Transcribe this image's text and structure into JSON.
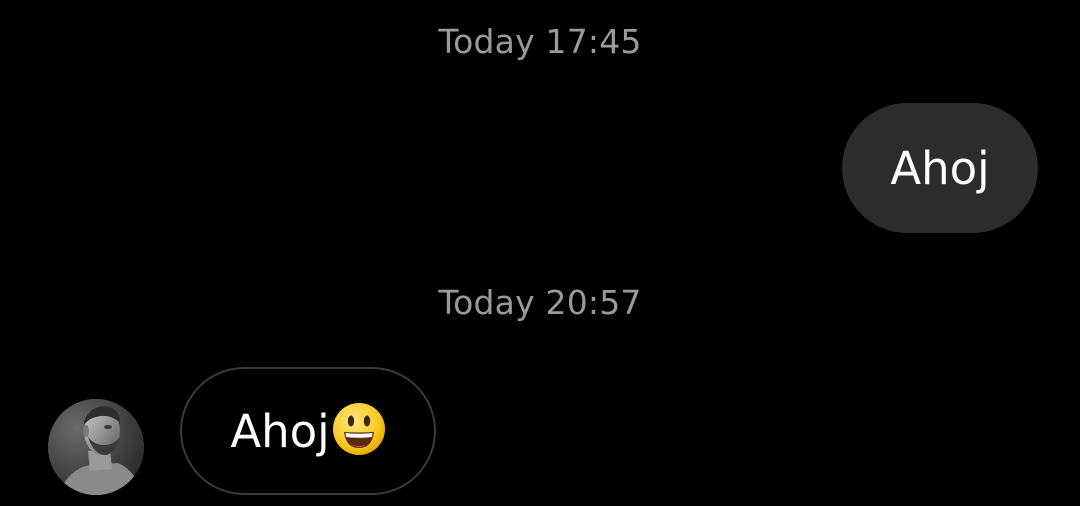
{
  "conversation": {
    "messages": [
      {
        "timestamp": "Today 17:45",
        "direction": "outgoing",
        "text": "Ahoj",
        "bubble_color": "#2c2c2c"
      },
      {
        "timestamp": "Today 20:57",
        "direction": "incoming",
        "text": "Ahoj",
        "emoji": "smiling-face-with-open-mouth-icon",
        "bubble_border_color": "#3a3a3a"
      }
    ]
  },
  "colors": {
    "background": "#000000",
    "timestamp_text": "#9a9a9a",
    "message_text": "#ffffff"
  }
}
